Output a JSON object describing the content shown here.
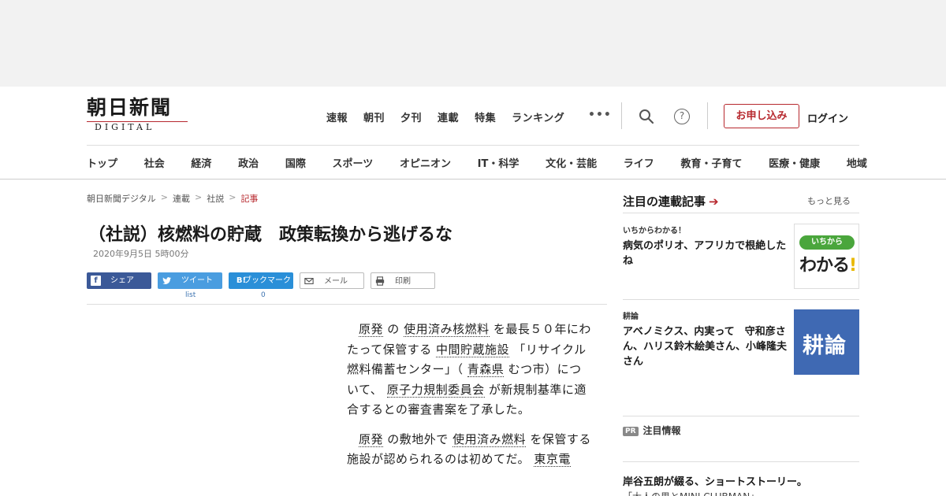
{
  "header": {
    "logo_jp": "朝日新聞",
    "logo_en": "DIGITAL",
    "topnav": [
      "速報",
      "朝刊",
      "夕刊",
      "連載",
      "特集",
      "ランキング"
    ],
    "more": "•••",
    "help": "?",
    "subscribe": "お申し込み",
    "login": "ログイン"
  },
  "catnav": [
    "トップ",
    "社会",
    "経済",
    "政治",
    "国際",
    "スポーツ",
    "オピニオン",
    "IT・科学",
    "文化・芸能",
    "ライフ",
    "教育・子育て",
    "医療・健康",
    "地域"
  ],
  "breadcrumb": {
    "items": [
      "朝日新聞デジタル",
      "連載",
      "社説"
    ],
    "current": "記事",
    "separator": ">"
  },
  "article": {
    "title": "（社説）核燃料の貯蔵　政策転換から逃げるな",
    "date": "2020年9月5日 5時00分"
  },
  "share": {
    "facebook": "シェア",
    "twitter": "ツイート",
    "hatena_icon": "B!",
    "hatena": "ブックマーク",
    "mail": "メール",
    "print": "印刷",
    "twitter_count": "list",
    "hatena_count": "0"
  },
  "body": {
    "p1": {
      "kw1": "原発",
      "t1": " の ",
      "kw2": "使用済み核燃料",
      "t2": " を最長５０年にわたって保管する ",
      "kw3": "中間貯蔵施設",
      "t3": " 「リサイクル燃料備蓄センター」（ ",
      "kw4": "青森県",
      "t4": " むつ市）について、 ",
      "kw5": "原子力規制委員会",
      "t5": " が新規制基準に適合するとの審査書案を了承した。"
    },
    "p2": {
      "kw1": "原発",
      "t1": " の敷地外で ",
      "kw2": "使用済み燃料",
      "t2": " を保管する施設が認められるのは初めてだ。 ",
      "kw3": "東京電"
    }
  },
  "sidebar": {
    "title": "注目の連載記事",
    "arrow": "➔",
    "more": "もっと見る",
    "items": [
      {
        "category": "いちからわかる！",
        "headline": "病気のポリオ、アフリカで根絶したね",
        "thumb_pill": "いちから",
        "thumb_big": "わかる",
        "thumb_excl": "!"
      },
      {
        "category": "耕論",
        "headline": "アベノミクス、内実って　守和彦さん、ハリス鈴木絵美さん、小峰隆夫さん",
        "thumb_text": "耕論"
      }
    ],
    "pr_badge": "PR",
    "pr_label": "注目情報",
    "promo_title": "岸谷五朗が綴る、ショートストーリー。",
    "promo_sub": "「大人の男とMINI CLUBMAN」"
  }
}
